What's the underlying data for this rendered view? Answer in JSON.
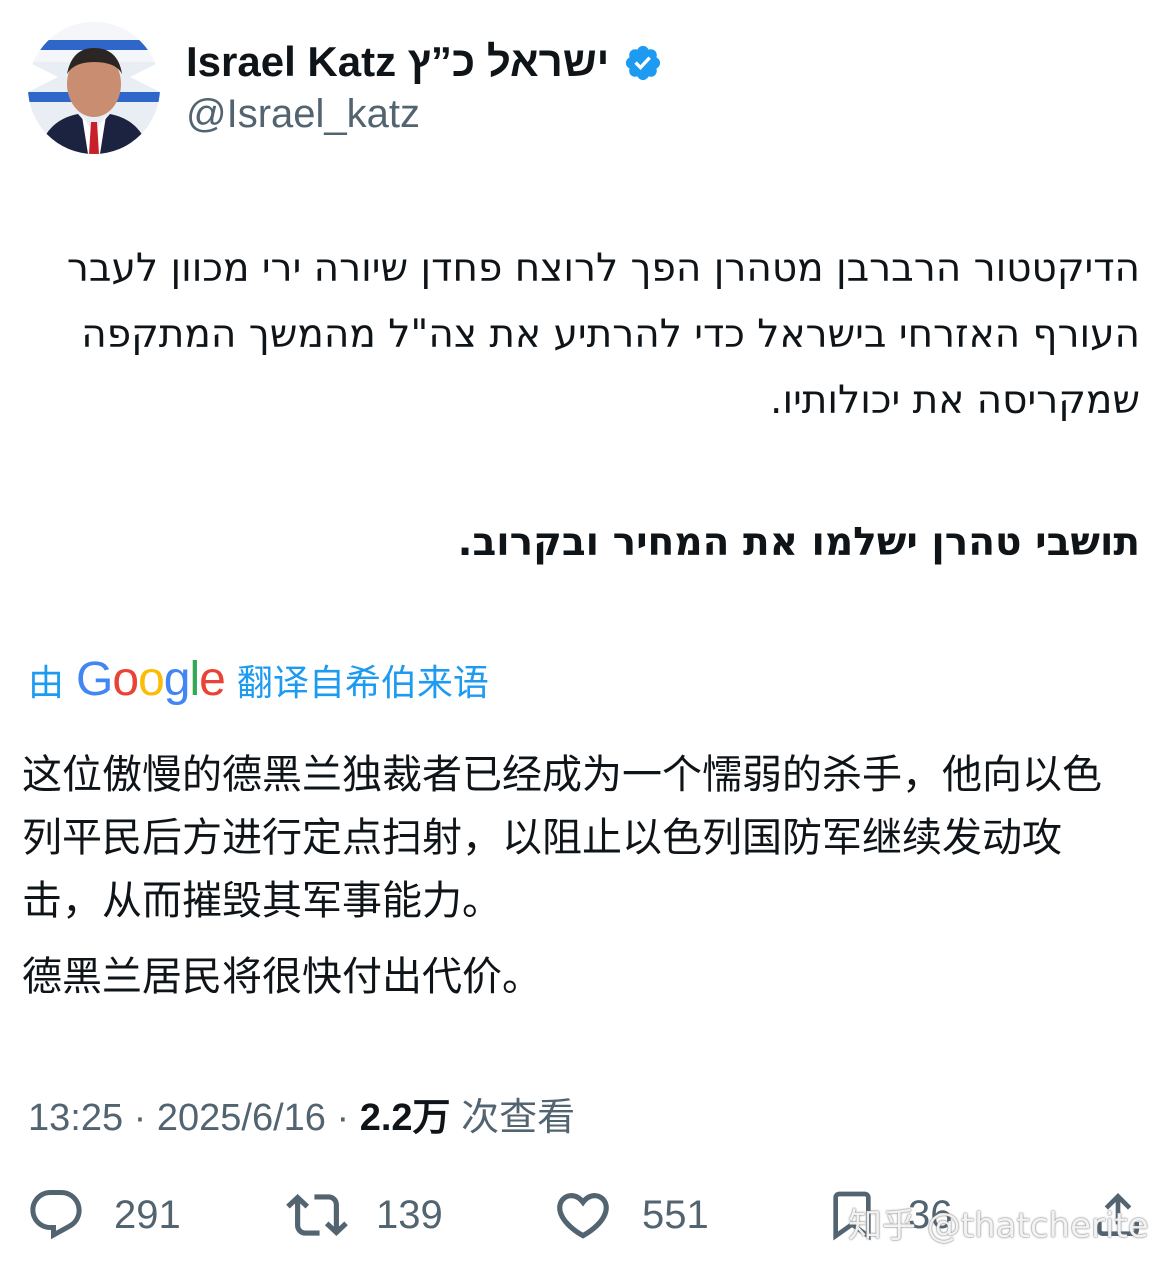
{
  "author": {
    "display_name": "Israel Katz ישראל כ”ץ",
    "handle": "@Israel_katz",
    "verified": true,
    "verified_color": "#1d9bf0"
  },
  "tweet": {
    "hebrew_paragraph_1": "הדיקטטור הרברבן מטהרן הפך לרוצח פחדן שיורה ירי מכוון לעבר העורף האזרחי בישראל כדי להרתיע את צה\"ל מהמשך המתקפה שמקריסה את יכולותיו.",
    "hebrew_paragraph_2": "תושבי טהרן ישלמו את המחיר ובקרוב.",
    "translated_by_prefix": "由",
    "translated_by_brand": "Google",
    "translated_by_suffix": "翻译自希伯来语",
    "translation_paragraph_1": "这位傲慢的德黑兰独裁者已经成为一个懦弱的杀手，他向以色列平民后方进行定点扫射，以阻止以色列国防军继续发动攻击，从而摧毁其军事能力。",
    "translation_paragraph_2": "德黑兰居民将很快付出代价。",
    "time": "13:25",
    "date": "2025/6/16",
    "separator": "·",
    "views_count": "2.2万",
    "views_label": "次查看"
  },
  "actions": {
    "reply_count": "291",
    "retweet_count": "139",
    "like_count": "551",
    "bookmark_count": "36"
  },
  "watermark": "知乎 @thatcherite",
  "colors": {
    "text_primary": "#0f1419",
    "text_secondary": "#536471",
    "accent": "#1d9bf0",
    "google_blue": "#4285F4",
    "google_red": "#EA4335",
    "google_yellow": "#FBBC05",
    "google_green": "#34A853"
  }
}
